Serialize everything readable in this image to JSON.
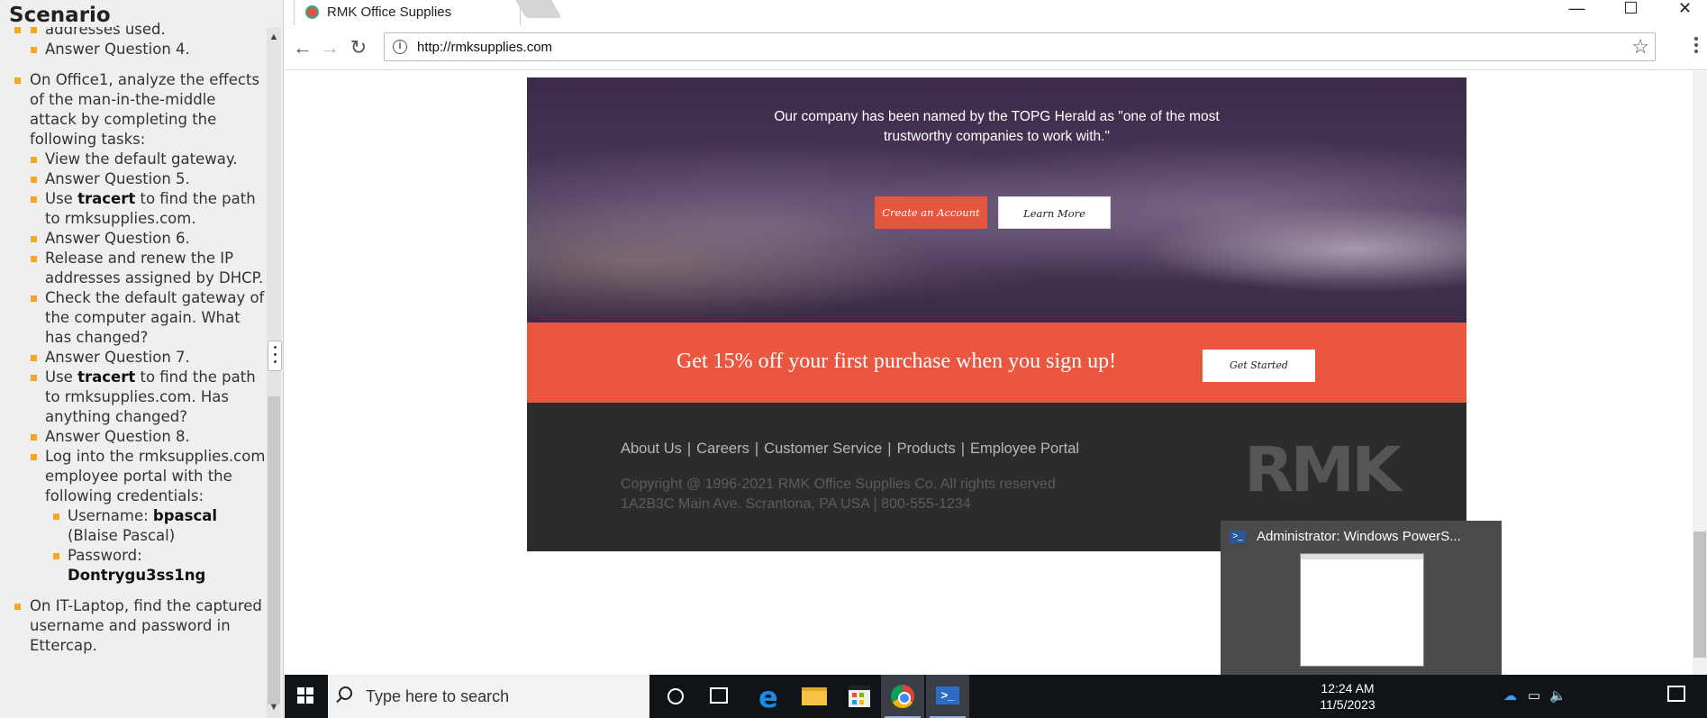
{
  "scenario": {
    "title": "Scenario",
    "items": {
      "l0": "addresses used.",
      "l1": "Answer Question 4.",
      "office1": "On Office1, analyze the effects of the man-in-the-middle attack by completing the following tasks:",
      "s1": "View the default gateway.",
      "s2": "Answer Question 5.",
      "s3_pre": "Use ",
      "s3_bold": "tracert",
      "s3_post": " to find the path to rmksupplies.com.",
      "s4": "Answer Question 6.",
      "s5": "Release and renew the IP addresses assigned by DHCP.",
      "s6": "Check the default gateway of the computer again. What has changed?",
      "s7": "Answer Question 7.",
      "s8_pre": "Use ",
      "s8_bold": "tracert",
      "s8_post": " to find the path to rmksupplies.com. Has anything changed?",
      "s9": "Answer Question 8.",
      "s10": "Log into the rmksupplies.com employee portal with the following credentials:",
      "u_label": "Username: ",
      "u_value": "bpascal",
      "u_name": "(Blaise Pascal)",
      "p_label": "Password:",
      "p_value": "Dontrygu3ss1ng",
      "laptop": "On IT-Laptop, find the captured username and password in Ettercap."
    }
  },
  "browser": {
    "tab_title": "RMK Office Supplies",
    "url": "http://rmksupplies.com",
    "window_controls": {
      "minimize": "—",
      "maximize": "☐",
      "close": "✕"
    }
  },
  "page": {
    "tagline_1": "Our company has been named by the TOPG Herald as \"one of the most",
    "tagline_2": "trustworthy companies to work with.\"",
    "create_account": "Create an Account",
    "learn_more": "Learn More",
    "promo_text": "Get 15% off your first purchase when you sign up!",
    "get_started": "Get Started",
    "footer_links": [
      "About Us",
      "Careers",
      "Customer Service",
      "Products",
      "Employee Portal"
    ],
    "copyright_1": "Copyright @ 1996-2021 RMK Office Supplies Co. All rights reserved",
    "copyright_2": "1A2B3C Main Ave. Scrantona, PA USA | 800-555-1234",
    "footer_logo": "RMK"
  },
  "preview": {
    "title": "Administrator: Windows PowerS..."
  },
  "taskbar": {
    "search_placeholder": "Type here to search",
    "time": "12:24 AM",
    "date": "11/5/2023"
  },
  "colors": {
    "accent_orange": "#ea5640",
    "footer_bg": "#2c2c2c",
    "bullet": "#f5a623"
  }
}
